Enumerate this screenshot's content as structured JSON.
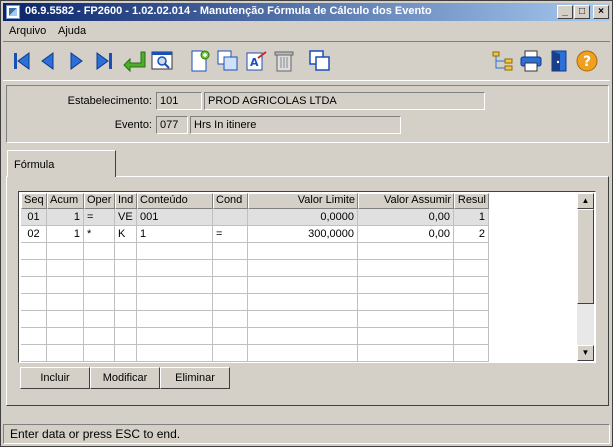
{
  "window": {
    "title": "06.9.5582 - FP2600 - 1.02.02.014 - Manutenção Fórmula de Cálculo dos Evento",
    "minimize": "_",
    "maximize": "□",
    "close": "×"
  },
  "menu": {
    "items": [
      {
        "label": "Arquivo"
      },
      {
        "label": "Ajuda"
      }
    ]
  },
  "toolbar": {
    "icons": [
      "first-record-icon",
      "previous-record-icon",
      "next-record-icon",
      "last-record-icon",
      "goto-icon",
      "zoom-icon",
      "new-document-icon",
      "copy-icon",
      "edit-icon",
      "delete-icon",
      "duplicate-icon",
      "tree-icon",
      "print-icon",
      "exit-icon",
      "help-icon"
    ]
  },
  "header": {
    "establishment": {
      "label": "Estabelecimento:",
      "code": "101",
      "name": "PROD AGRICOLAS LTDA"
    },
    "event": {
      "label": "Evento:",
      "code": "077",
      "name": "Hrs In itinere"
    }
  },
  "tab": {
    "label": "Fórmula"
  },
  "grid": {
    "columns": [
      "Seq",
      "Acum",
      "Oper",
      "Ind",
      "Conteúdo",
      "Cond",
      "Valor Limite",
      "Valor Assumir",
      "Resul"
    ],
    "rows": [
      {
        "seq": "01",
        "acum": "1",
        "oper": "=",
        "ind": "VE",
        "conteudo": "001",
        "cond": "",
        "valor_limite": "0,0000",
        "valor_assumir": "0,00",
        "resul": "1"
      },
      {
        "seq": "02",
        "acum": "1",
        "oper": "*",
        "ind": "K",
        "conteudo": "1",
        "cond": "=",
        "valor_limite": "300,0000",
        "valor_assumir": "0,00",
        "resul": "2"
      }
    ]
  },
  "actions": {
    "include": "Incluir",
    "modify": "Modificar",
    "remove": "Eliminar"
  },
  "status": {
    "text": "Enter data or press ESC to end."
  }
}
